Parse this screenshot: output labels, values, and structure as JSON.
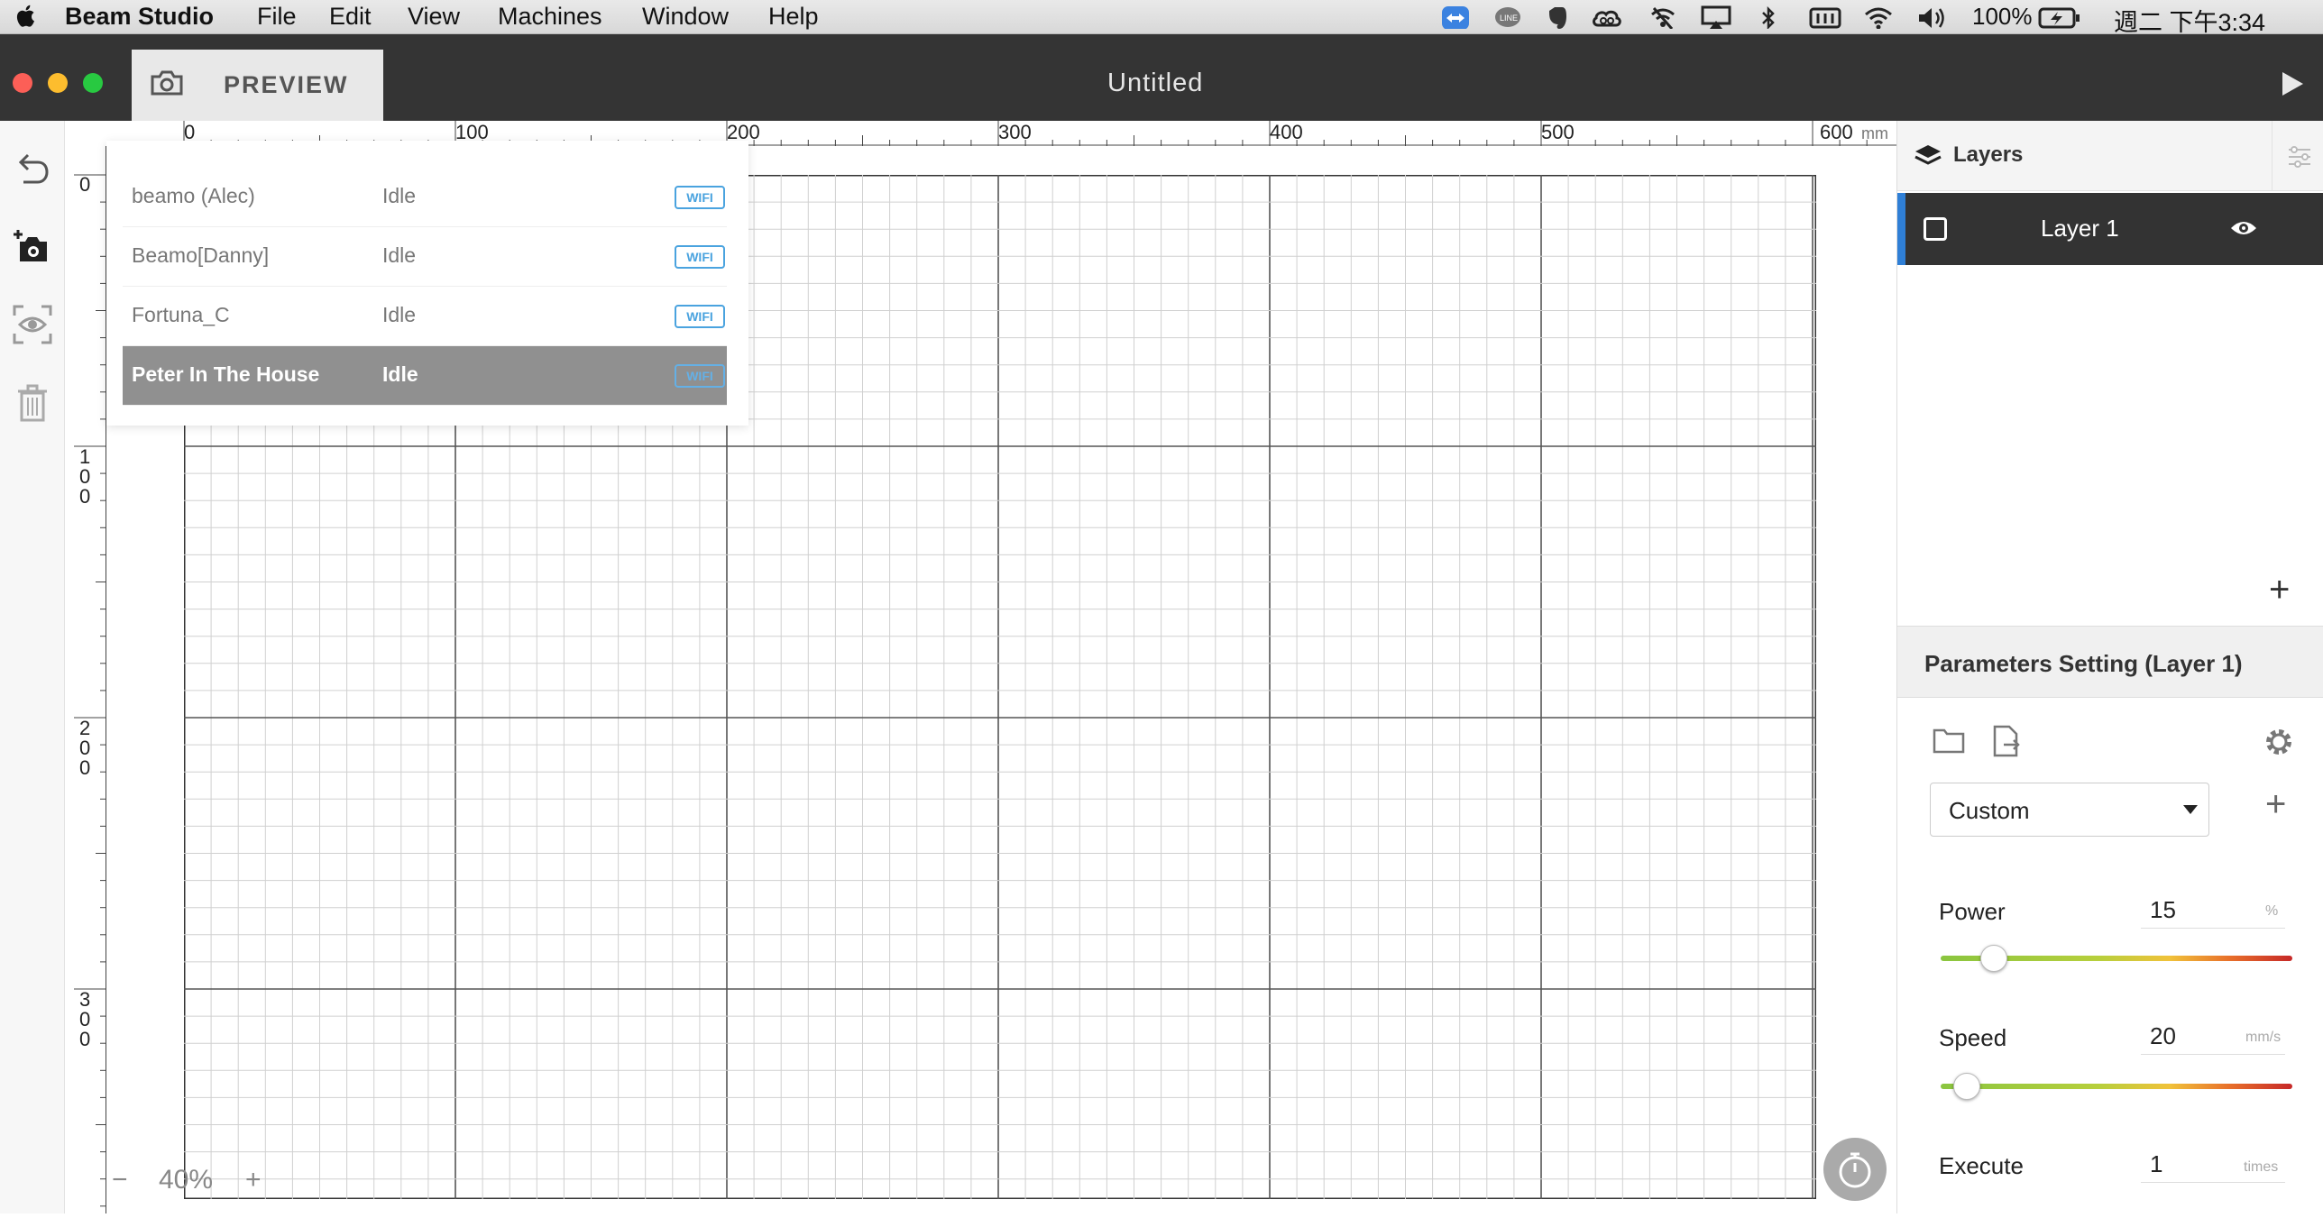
{
  "menubar": {
    "app_name": "Beam Studio",
    "menus": [
      "File",
      "Edit",
      "View",
      "Machines",
      "Window",
      "Help"
    ],
    "battery": "100%",
    "clock": "週二 下午3:34",
    "tray_icons": [
      "teamviewer-icon",
      "line-icon",
      "evernote-icon",
      "creative-cloud-icon",
      "wifi-off-icon",
      "airplay-icon",
      "bluetooth-icon",
      "input-method-icon",
      "wifi-icon",
      "volume-icon",
      "battery-icon"
    ]
  },
  "titlebar": {
    "preview_label": "PREVIEW",
    "document_title": "Untitled"
  },
  "ruler": {
    "top_labels": [
      "0",
      "100",
      "200",
      "300",
      "400",
      "500",
      "600"
    ],
    "unit": "mm",
    "left_labels": [
      "0",
      "100",
      "200",
      "300"
    ]
  },
  "machines": [
    {
      "name": "beamo (Alec)",
      "status": "Idle",
      "connection": "WIFI"
    },
    {
      "name": "Beamo[Danny]",
      "status": "Idle",
      "connection": "WIFI"
    },
    {
      "name": "Fortuna_C",
      "status": "Idle",
      "connection": "WIFI"
    },
    {
      "name": "Peter In The House",
      "status": "Idle",
      "connection": "WIFI"
    }
  ],
  "zoom": {
    "minus": "−",
    "value": "40%",
    "plus": "+"
  },
  "layers": {
    "title": "Layers",
    "items": [
      {
        "name": "Layer 1"
      }
    ],
    "add": "+"
  },
  "parameters": {
    "title": "Parameters Setting (Layer 1)",
    "preset": "Custom",
    "preset_add": "+",
    "power": {
      "label": "Power",
      "value": "15",
      "unit": "%",
      "fraction": 0.15
    },
    "speed": {
      "label": "Speed",
      "value": "20",
      "unit": "mm/s",
      "fraction": 0.075
    },
    "execute": {
      "label": "Execute",
      "value": "1",
      "unit": "times"
    }
  },
  "colors": {
    "titlebar": "#343434",
    "selected_layer_accent": "#2f7fd6",
    "wifi_badge": "#4aa3df"
  }
}
